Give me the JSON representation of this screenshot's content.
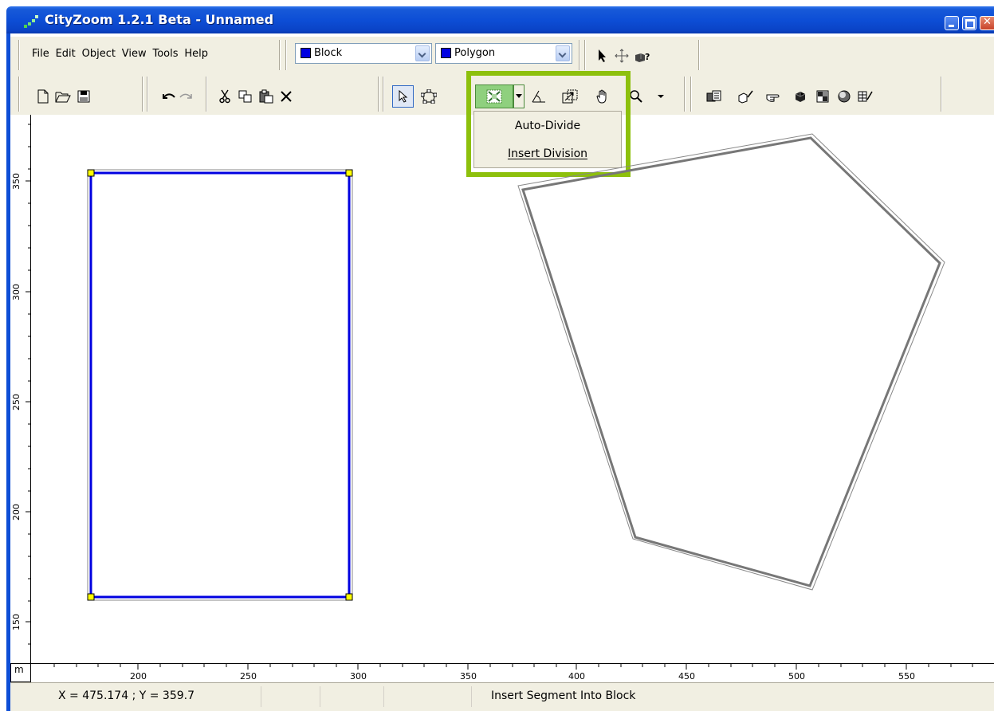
{
  "window": {
    "title": "CityZoom 1.2.1 Beta - Unnamed"
  },
  "menu": {
    "items": [
      "File",
      "Edit",
      "Object",
      "View",
      "Tools",
      "Help"
    ]
  },
  "combos": {
    "object_type": {
      "value": "Block",
      "color": "#0000e0"
    },
    "shape_type": {
      "value": "Polygon",
      "color": "#0000e0"
    }
  },
  "toolbar": {
    "row1_tools": [
      "pointer-arrow-icon",
      "move-cross-icon",
      "query-object-icon"
    ],
    "file_tools": [
      "new-file-icon",
      "open-folder-icon",
      "save-disk-icon"
    ],
    "edit_tools": [
      "undo-icon",
      "redo-icon",
      "cut-icon",
      "copy-icon",
      "paste-icon",
      "delete-icon"
    ],
    "draw_tools": [
      "select-icon",
      "vertex-edit-icon",
      "divide-icon",
      "dropdown-arrow-icon",
      "angle-icon",
      "resize-icon",
      "pan-hand-icon",
      "zoom-icon",
      "zoom-dropdown-icon"
    ],
    "view_tools": [
      "copy-block-icon",
      "edit-block-icon",
      "point-hand-icon",
      "solid-cube-icon",
      "checker-icon",
      "sphere-icon",
      "table-edit-icon"
    ]
  },
  "dropdown": {
    "items": [
      "Auto-Divide",
      "Insert Division"
    ]
  },
  "rulers": {
    "unit": "m",
    "x_ticks": [
      "200",
      "250",
      "300",
      "350",
      "400",
      "450",
      "500",
      "550"
    ],
    "y_ticks": [
      "350",
      "300",
      "250",
      "200",
      "150"
    ]
  },
  "status": {
    "coords": "X = 475.174 ;  Y = 359.7",
    "message": "Insert Segment Into Block"
  },
  "colors": {
    "highlight": "#8dc00c",
    "block_outline": "#0000e0",
    "handle": "#ffff00"
  }
}
